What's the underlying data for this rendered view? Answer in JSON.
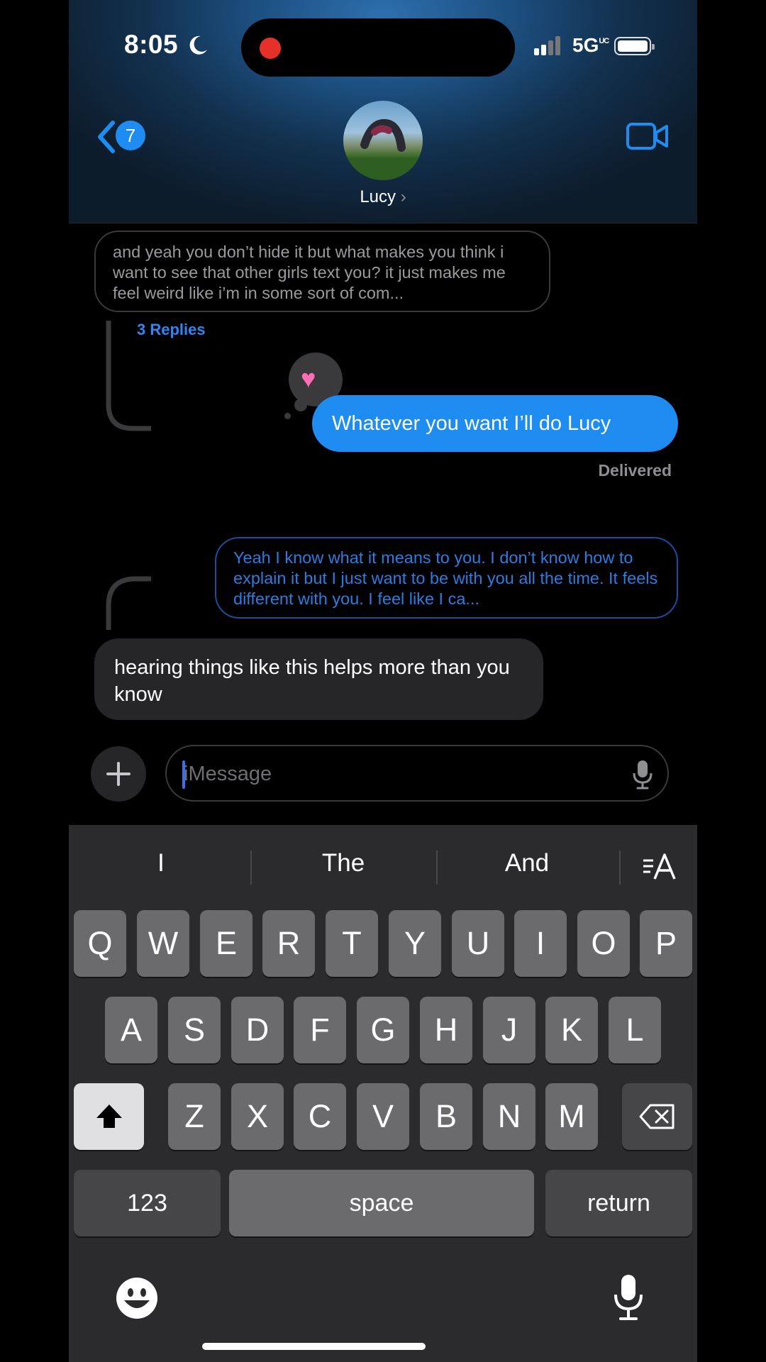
{
  "status_bar": {
    "time": "8:05",
    "network": "5G",
    "network_suffix": "UC"
  },
  "header": {
    "back_badge_count": "7",
    "contact_name": "Lucy",
    "contact_chevron": "›"
  },
  "messages": [
    {
      "text": "and yeah you don’t hide it but what makes you think i want to see that other girls text you? it just makes me feel weird like i’m in some sort of com...",
      "direction": "incoming",
      "style": "reply-thread-quoted"
    },
    {
      "text": "Whatever you want I’ll do Lucy",
      "direction": "outgoing",
      "reaction": "heart",
      "status": "Delivered"
    },
    {
      "text": "Yeah I know what it means to you. I don’t know how to explain it but I just want to be with you all the time. It feels different with you. I feel like I ca...",
      "direction": "outgoing",
      "style": "reply-thread-quoted"
    },
    {
      "text": "hearing things like this helps more than you know",
      "direction": "incoming"
    }
  ],
  "thread": {
    "replies_label": "3 Replies"
  },
  "composer": {
    "placeholder": "iMessage",
    "value": ""
  },
  "keyboard": {
    "suggestions": [
      "I",
      "The",
      "And"
    ],
    "row1": [
      "Q",
      "W",
      "E",
      "R",
      "T",
      "Y",
      "U",
      "I",
      "O",
      "P"
    ],
    "row2": [
      "A",
      "S",
      "D",
      "F",
      "G",
      "H",
      "J",
      "K",
      "L"
    ],
    "row3": [
      "Z",
      "X",
      "C",
      "V",
      "B",
      "N",
      "M"
    ],
    "numbers_label": "123",
    "space_label": "space",
    "return_label": "return"
  },
  "colors": {
    "accent_blue": "#1e8cf0",
    "incoming_bubble": "#262629",
    "keyboard_bg": "#2b2b2d",
    "recording_dot": "#e8302a"
  },
  "icons": [
    "moon-icon",
    "signal-icon",
    "battery-icon",
    "back-chevron-icon",
    "video-call-icon",
    "heart-reaction-icon",
    "plus-icon",
    "microphone-icon",
    "shift-icon",
    "delete-icon",
    "text-format-icon",
    "emoji-icon",
    "dictation-icon"
  ]
}
